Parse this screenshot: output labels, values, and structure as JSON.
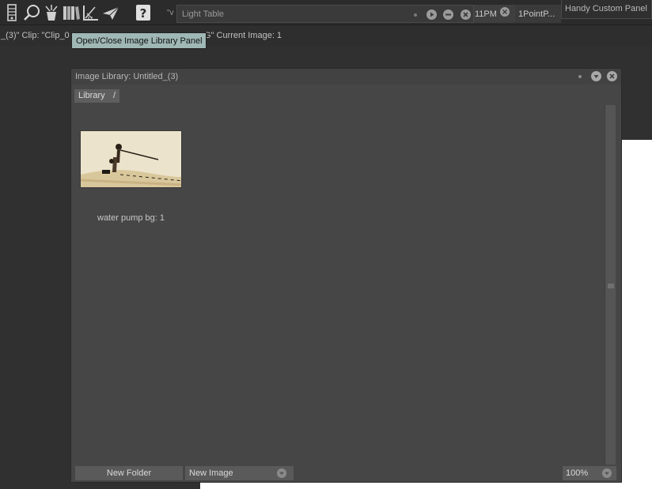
{
  "toolbar": {
    "icons": [
      "layers-palette-icon",
      "search-icon",
      "magic-hat-icon",
      "image-library-icon",
      "ruler-grid-icon",
      "paper-plane-icon",
      "help-icon"
    ],
    "help_glyph": "?",
    "lighttable_prefix": "\"v",
    "lighttable_title": "Light Table",
    "tab_11pm": "11PM",
    "tab_1point": "1PointP...",
    "handy_panel": "Handy Custom Panel"
  },
  "status": {
    "left": "_(3)\"  Clip: \"Clip_0",
    "right": "G\"  Current Image: 1"
  },
  "tooltip": "Open/Close Image Library Panel",
  "panel": {
    "title": "Image Library: Untitled_(3)",
    "breadcrumb": [
      "Library",
      "/"
    ],
    "thumbnail_caption": "water pump bg: 1",
    "new_folder": "New Folder",
    "new_image": "New Image",
    "zoom": "100%"
  },
  "colors": {
    "toolbar_bg": "#2b2b2b",
    "panel_bg": "#464646",
    "tooltip_bg": "#9fb8b6",
    "button_bg": "#5a5a5a"
  }
}
